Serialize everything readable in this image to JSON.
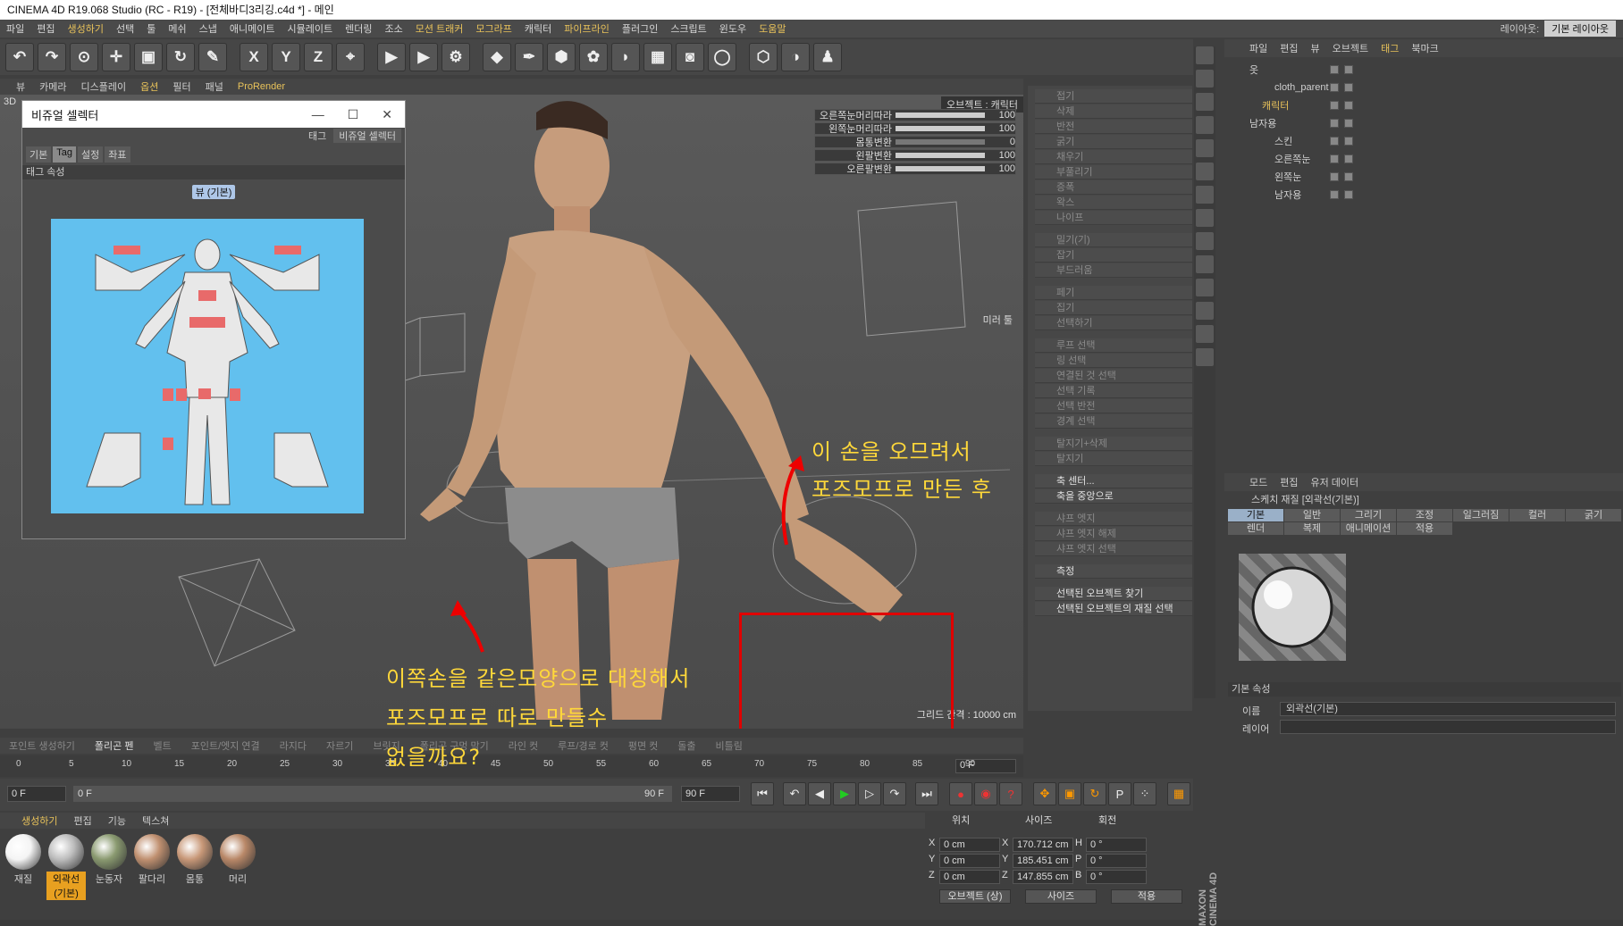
{
  "window": {
    "title": "CINEMA 4D R19.068 Studio (RC - R19) - [전체바디3리깅.c4d *] - 메인"
  },
  "menu": [
    "파일",
    "편집",
    "생성하기",
    "선택",
    "툴",
    "메쉬",
    "스냅",
    "애니메이트",
    "시뮬레이트",
    "렌더링",
    "조소",
    "모션 트래커",
    "모그라프",
    "캐릭터",
    "파이프라인",
    "플러그인",
    "스크립트",
    "윈도우",
    "도움말"
  ],
  "menu_highlight": [
    2,
    11,
    12,
    14,
    18
  ],
  "layout": {
    "label": "레이아웃:",
    "value": "기본 레이아웃"
  },
  "toolbar_icons": [
    "undo-icon",
    "redo-icon",
    "live-select-icon",
    "move-icon",
    "scale-icon",
    "rotate-icon",
    "recent-tools-icon",
    "x-axis-icon",
    "y-axis-icon",
    "z-axis-icon",
    "world-coords-icon",
    "render-view-icon",
    "render-picture-icon",
    "render-settings-icon",
    "cube-icon",
    "pen-icon",
    "subdivision-icon",
    "cloner-icon",
    "deformer-icon",
    "floor-icon",
    "camera-icon",
    "light-icon",
    "add-icon",
    "half-sphere-icon",
    "figure-icon"
  ],
  "toolbar_glyphs": {
    "x": "X",
    "y": "Y",
    "z": "Z"
  },
  "viewport_menu": [
    "뷰",
    "카메라",
    "디스플레이",
    "옵션",
    "필터",
    "패널",
    "ProRender"
  ],
  "viewport_menu_highlight": [
    3,
    6
  ],
  "viewport": {
    "label": "3D",
    "grid": "그리드 간격 : 10000 cm",
    "object_badge": "오브젝트 : 캐릭터",
    "mirror": "미러 툴"
  },
  "sliders": [
    {
      "label": "오른쪽눈머리따라",
      "value": "100",
      "level": 1.0
    },
    {
      "label": "왼쪽눈머리따라",
      "value": "100",
      "level": 1.0
    },
    {
      "label": "몸통변환",
      "value": "0",
      "level": 0.0
    },
    {
      "label": "왼팔변환",
      "value": "100",
      "level": 1.0
    },
    {
      "label": "오른팔변환",
      "value": "100",
      "level": 1.0
    }
  ],
  "visual_selector": {
    "title": "비쥬얼 셀렉터",
    "tabs": [
      "기본",
      "Tag",
      "설정",
      "좌표"
    ],
    "active_tab": 1,
    "tag_label": "태그",
    "tag_value": "비쥬얼 셀렉터",
    "section": "태그 속성",
    "view_button": "뷰 (기본)"
  },
  "right_tools": [
    {
      "label": "접기",
      "on": false
    },
    {
      "label": "삭제",
      "on": false
    },
    {
      "label": "반전",
      "on": false
    },
    {
      "label": "굵기",
      "on": false
    },
    {
      "label": "채우기",
      "on": false
    },
    {
      "label": "부풀리기",
      "on": false
    },
    {
      "label": "증폭",
      "on": false
    },
    {
      "label": "왁스",
      "on": false
    },
    {
      "label": "나이프",
      "on": false
    },
    {
      "label": "밀기(기)",
      "on": false
    },
    {
      "label": "잡기",
      "on": false
    },
    {
      "label": "부드러움",
      "on": false
    },
    {
      "label": "페기",
      "on": false
    },
    {
      "label": "집기",
      "on": false
    },
    {
      "label": "선택하기",
      "on": false
    },
    {
      "label": "루프 선택",
      "on": false
    },
    {
      "label": "링 선택",
      "on": false
    },
    {
      "label": "연결된 것 선택",
      "on": false
    },
    {
      "label": "선택 기록",
      "on": false
    },
    {
      "label": "선택 반전",
      "on": false
    },
    {
      "label": "경계 선택",
      "on": false
    },
    {
      "label": "탈지기+삭제",
      "on": false
    },
    {
      "label": "탈지기",
      "on": false
    },
    {
      "label": "축 센터...",
      "on": true
    },
    {
      "label": "축을 중앙으로",
      "on": true
    },
    {
      "label": "샤프 엣지",
      "on": false
    },
    {
      "label": "샤프 엣지 해제",
      "on": false
    },
    {
      "label": "샤프 엣지 선택",
      "on": false
    },
    {
      "label": "측정",
      "on": true
    },
    {
      "label": "선택된 오브젝트 찾기",
      "on": true
    },
    {
      "label": "선택된 오브젝트의 재질 선택",
      "on": true
    }
  ],
  "object_manager": {
    "menu": [
      "파일",
      "편집",
      "뷰",
      "오브젝트",
      "태그",
      "북마크"
    ],
    "menu_highlight": 4,
    "objects": [
      {
        "name": "옷",
        "indent": 0,
        "hl": false
      },
      {
        "name": "cloth_parent",
        "indent": 2,
        "hl": false
      },
      {
        "name": "캐릭터",
        "indent": 1,
        "hl": true
      },
      {
        "name": "남자용",
        "indent": 0,
        "hl": false
      },
      {
        "name": "스킨",
        "indent": 2,
        "hl": false
      },
      {
        "name": "오른쪽눈",
        "indent": 2,
        "hl": false
      },
      {
        "name": "왼쪽눈",
        "indent": 2,
        "hl": false
      },
      {
        "name": "남자용",
        "indent": 2,
        "hl": false
      }
    ]
  },
  "attributes": {
    "menu": [
      "모드",
      "편집",
      "유저 데이터"
    ],
    "title": "스케치 재질 [외곽선(기본)]",
    "tabs": [
      "기본",
      "일반",
      "그리기",
      "조정",
      "일그러짐",
      "컬러",
      "굵기",
      "렌더",
      "복제",
      "애니메이션",
      "적용"
    ],
    "active_tab": 0,
    "section": "기본 속성",
    "fields": [
      {
        "label": "이름",
        "value": "외곽선(기본)"
      },
      {
        "label": "레이어",
        "value": ""
      }
    ]
  },
  "modebar": [
    "포인트 생성하기",
    "폴리곤 펜",
    "벨트",
    "포인트/엣지 연결",
    "라지다",
    "자르기",
    "브릿지",
    "폴리곤 구멍 막기",
    "라인 컷",
    "루프/경로 컷",
    "평면 컷",
    "돌출",
    "비틀림"
  ],
  "modebar_on": [
    1
  ],
  "timeline": {
    "ticks": [
      "0",
      "5",
      "10",
      "15",
      "20",
      "25",
      "30",
      "35",
      "40",
      "45",
      "50",
      "55",
      "60",
      "65",
      "70",
      "75",
      "80",
      "85",
      "90"
    ],
    "frame": "0 F"
  },
  "transport": {
    "start": "0 F",
    "range_start": "0 F",
    "range_end": "90 F",
    "end": "90 F"
  },
  "material_menu": [
    "생성하기",
    "편집",
    "기능",
    "텍스쳐"
  ],
  "materials": [
    {
      "name": "재질",
      "color": "#f4f4f4",
      "selected": false
    },
    {
      "name": "외곽선(기본)",
      "color": "#bdbdbd",
      "selected": true
    },
    {
      "name": "눈동자",
      "color": "#8a9a70",
      "selected": false
    },
    {
      "name": "팔다리",
      "color": "#c09070",
      "selected": false
    },
    {
      "name": "몸통",
      "color": "#c89878",
      "selected": false
    },
    {
      "name": "머리",
      "color": "#b98868",
      "selected": false
    }
  ],
  "coords": {
    "headers": [
      "위치",
      "사이즈",
      "회전"
    ],
    "rows": [
      {
        "axis": "X",
        "pos": "0 cm",
        "axis2": "X",
        "size": "170.712 cm",
        "axis3": "H",
        "rot": "0 °"
      },
      {
        "axis": "Y",
        "pos": "0 cm",
        "axis2": "Y",
        "size": "185.451 cm",
        "axis3": "P",
        "rot": "0 °"
      },
      {
        "axis": "Z",
        "pos": "0 cm",
        "axis2": "Z",
        "size": "147.855 cm",
        "axis3": "B",
        "rot": "0 °"
      }
    ],
    "mode1": "오브젝트 (상)",
    "mode2": "사이즈",
    "apply": "적용"
  },
  "annotations": {
    "top1": "이 손을 오므려서",
    "top2": "포즈모프로 만든 후",
    "bottom1": "이쪽손을 같은모양으로 대칭해서",
    "bottom2": "포즈모프로 따로 만들수",
    "bottom3": "없을까요?"
  },
  "brand": "MAXON CINEMA 4D"
}
